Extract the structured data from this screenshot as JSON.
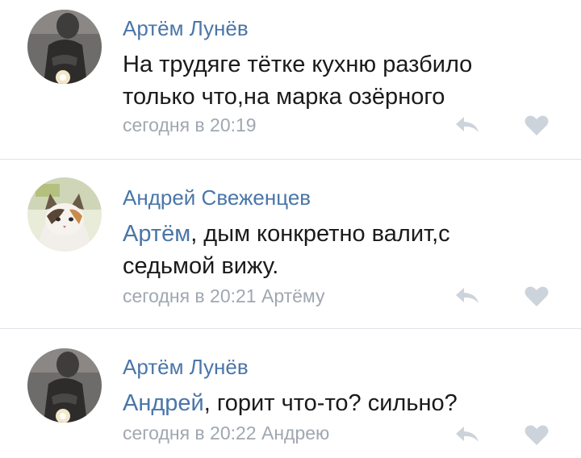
{
  "comments": [
    {
      "author": "Артём Лунёв",
      "mention": "",
      "text": "На трудяге тётке кухню разбило только что,на марка озёрного",
      "time": "сегодня в 20:19",
      "reply_to": "",
      "reply_icon": "reply-icon",
      "like_icon": "heart-icon"
    },
    {
      "author": "Андрей Свеженцев",
      "mention": "Артём",
      "text": ", дым конкретно валит,с седьмой вижу.",
      "time": "сегодня в 20:21",
      "reply_to": "Артёму",
      "reply_icon": "reply-icon",
      "like_icon": "heart-icon"
    },
    {
      "author": "Артём Лунёв",
      "mention": "Андрей",
      "text": ", горит что-то? сильно?",
      "time": "сегодня в 20:22",
      "reply_to": "Андрею",
      "reply_icon": "reply-icon",
      "like_icon": "heart-icon"
    }
  ],
  "colors": {
    "link": "#4a76a8",
    "text": "#1a1a1a",
    "meta": "#a0a7b0",
    "icon": "#ccd3db",
    "divider": "#dfe3e8"
  }
}
